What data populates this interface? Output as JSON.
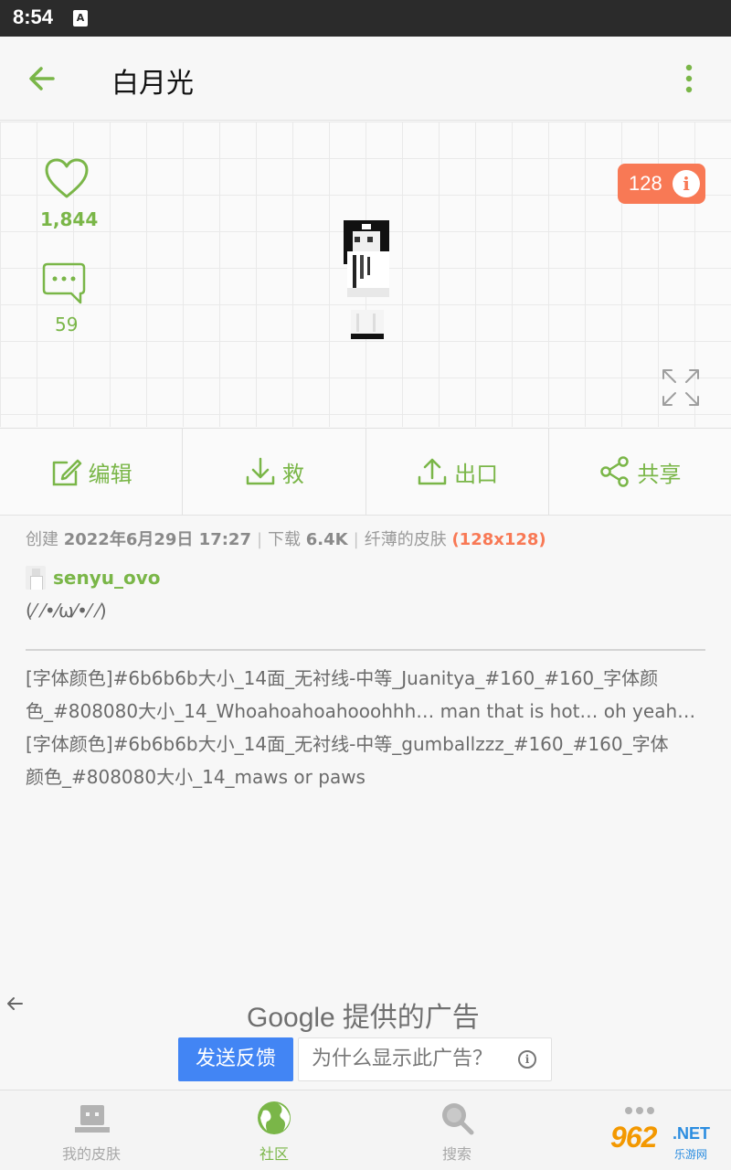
{
  "status_bar": {
    "time": "8:54",
    "notification_icon": "accessibility-A"
  },
  "app_bar": {
    "title": "白月光",
    "back_icon": "arrow-left-icon",
    "more_icon": "overflow-menu-icon"
  },
  "preview": {
    "likes": "1,844",
    "comments": "59",
    "resolution_badge": "128",
    "info_glyph": "i",
    "accent_color": "#7ab648",
    "badge_color": "#f87955"
  },
  "actions": [
    {
      "label": "编辑",
      "icon": "edit-icon"
    },
    {
      "label": "救",
      "icon": "download-icon"
    },
    {
      "label": "出口",
      "icon": "upload-icon"
    },
    {
      "label": "共享",
      "icon": "share-icon"
    }
  ],
  "meta": {
    "created_label": "创建",
    "created_value": "2022年6月29日 17:27",
    "downloads_label": "下载",
    "downloads_value": "6.4K",
    "type": "纤薄的皮肤",
    "resolution": "(128x128)"
  },
  "author": {
    "name": "senyu_ovo"
  },
  "bio": "(⁄ ⁄•⁄ω⁄•⁄ ⁄)",
  "description_lines": [
    "[字体颜色]#6b6b6b大小_14面_无衬线-中等_Juanitya_#160_#160_字体颜",
    "色_#808080大小_14_Whoahoahoahooohhh… man that is hot… oh yeah…",
    "[字体颜色]#6b6b6b大小_14面_无衬线-中等_gumballzzz_#160_#160_字体",
    "颜色_#808080大小_14_maws or paws"
  ],
  "ad": {
    "brand": "Google",
    "title": "提供的广告",
    "feedback_button": "发送反馈",
    "why_button": "为什么显示此广告？",
    "info_glyph": "i",
    "feedback_color": "#4285f4"
  },
  "bottom_nav": [
    {
      "label": "我的皮肤",
      "icon": "skin-icon",
      "active": false
    },
    {
      "label": "社区",
      "icon": "globe-icon",
      "active": true
    },
    {
      "label": "搜索",
      "icon": "search-icon",
      "active": false
    },
    {
      "label": "",
      "icon": "more-dots-icon",
      "active": false
    }
  ],
  "watermark": {
    "brand_number": "962",
    "brand_dot": ".",
    "brand_net": "NET",
    "cn_text": "乐游网"
  }
}
